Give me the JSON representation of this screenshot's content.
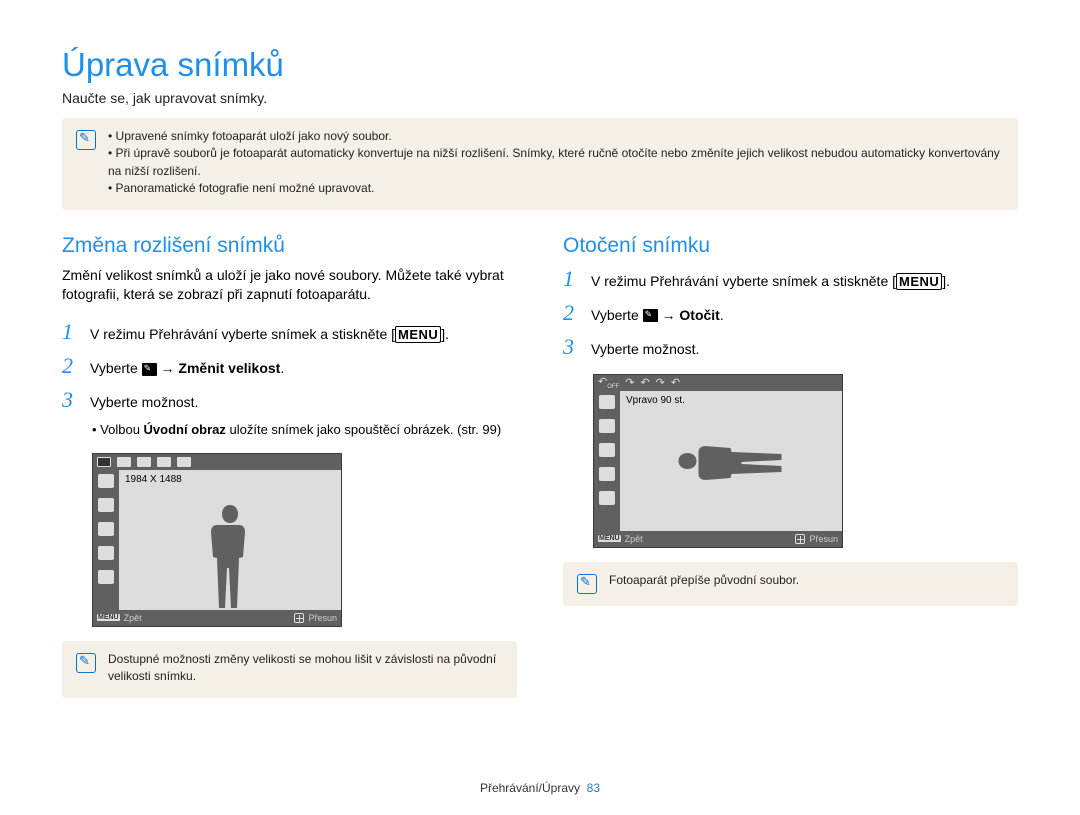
{
  "page": {
    "title": "Úprava snímků",
    "subtitle": "Naučte se, jak upravovat snímky.",
    "footer_section": "Přehrávání/Úpravy",
    "footer_page": "83"
  },
  "top_note": {
    "items": [
      "Upravené snímky fotoaparát uloží jako nový soubor.",
      "Při úpravě souborů je fotoaparát automaticky konvertuje na nižší rozlišení. Snímky, které ručně otočíte nebo změníte jejich velikost nebudou automaticky konvertovány na nižší rozlišení.",
      "Panoramatické fotografie není možné upravovat."
    ]
  },
  "left": {
    "section_title": "Změna rozlišení snímků",
    "section_desc": "Změní velikost snímků a uloží je jako nové soubory. Můžete také vybrat fotografii, která se zobrazí při zapnutí fotoaparátu.",
    "step1_pre": "V režimu Přehrávání vyberte snímek a stiskněte [",
    "step1_badge": "MENU",
    "step1_post": "].",
    "step2_pre": "Vyberte ",
    "step2_arrow_bold": "Změnit velikost",
    "step2_post": ".",
    "step3": "Vyberte možnost.",
    "bullet_pre": "Volbou ",
    "bullet_bold": "Úvodní obraz",
    "bullet_post": " uložíte snímek jako spouštěcí obrázek. (str. 99)",
    "screen_label": "1984 X 1488",
    "screen_back": "Zpět",
    "screen_move": "Přesun",
    "note": "Dostupné možnosti změny velikosti se mohou lišit v závislosti na původní velikosti snímku."
  },
  "right": {
    "section_title": "Otočení snímku",
    "step1_pre": "V režimu Přehrávání vyberte snímek a stiskněte [",
    "step1_badge": "MENU",
    "step1_post": "].",
    "step2_pre": "Vyberte ",
    "step2_arrow_bold": "Otočit",
    "step2_post": ".",
    "step3": "Vyberte možnost.",
    "screen_label": "Vpravo 90 st.",
    "screen_back": "Zpět",
    "screen_move": "Přesun",
    "note": "Fotoaparát přepíše původní soubor."
  }
}
